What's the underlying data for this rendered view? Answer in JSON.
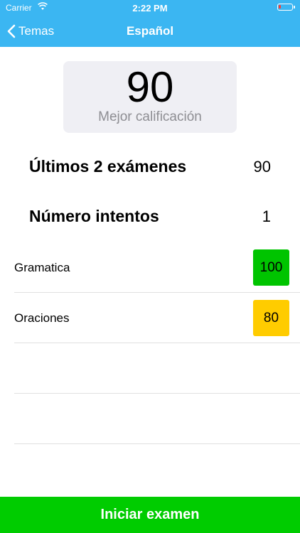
{
  "status_bar": {
    "carrier": "Carrier",
    "time": "2:22 PM"
  },
  "nav": {
    "back_label": "Temas",
    "title": "Español"
  },
  "score_card": {
    "value": "90",
    "label": "Mejor calificación"
  },
  "stats": [
    {
      "label": "Últimos 2 exámenes",
      "value": "90"
    },
    {
      "label": "Número intentos",
      "value": "1"
    }
  ],
  "topics": [
    {
      "name": "Gramatica",
      "score": "100",
      "color": "#00c400"
    },
    {
      "name": "Oraciones",
      "score": "80",
      "color": "#ffcc00"
    }
  ],
  "start_button": {
    "label": "Iniciar examen",
    "color": "#00cc00"
  },
  "colors": {
    "header": "#3bb6f2",
    "card_bg": "#efeff4"
  },
  "icons": {
    "back": "chevron-left-icon",
    "wifi": "wifi-icon",
    "battery": "battery-icon"
  }
}
